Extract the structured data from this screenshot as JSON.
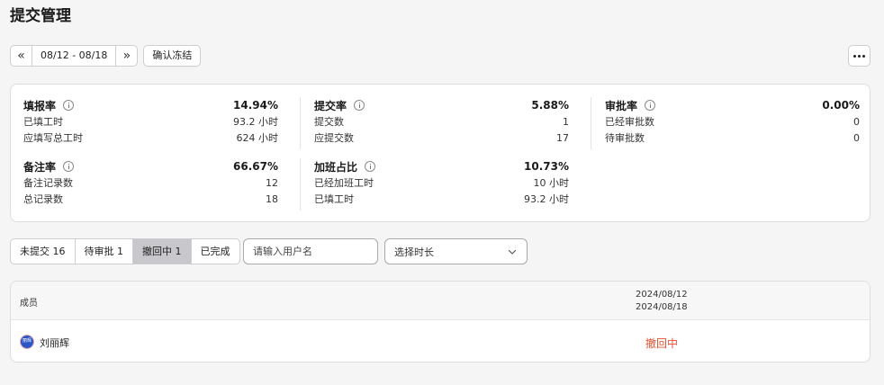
{
  "page": {
    "title": "提交管理"
  },
  "toolbar": {
    "prev_icon": "«",
    "next_icon": "»",
    "date_range": "08/12 - 08/18",
    "confirm_freeze_label": "确认冻结",
    "more_icon": "more-horizontal-icon"
  },
  "stats": {
    "fill_rate": {
      "name": "填报率",
      "value": "14.94%",
      "rows": [
        {
          "label": "已填工时",
          "value": "93.2 小时"
        },
        {
          "label": "应填写总工时",
          "value": "624 小时"
        }
      ]
    },
    "submit_rate": {
      "name": "提交率",
      "value": "5.88%",
      "rows": [
        {
          "label": "提交数",
          "value": "1"
        },
        {
          "label": "应提交数",
          "value": "17"
        }
      ]
    },
    "approve_rate": {
      "name": "审批率",
      "value": "0.00%",
      "rows": [
        {
          "label": "已经审批数",
          "value": "0"
        },
        {
          "label": "待审批数",
          "value": "0"
        }
      ]
    },
    "remark_rate": {
      "name": "备注率",
      "value": "66.67%",
      "rows": [
        {
          "label": "备注记录数",
          "value": "12"
        },
        {
          "label": "总记录数",
          "value": "18"
        }
      ]
    },
    "overtime_ratio": {
      "name": "加班占比",
      "value": "10.73%",
      "rows": [
        {
          "label": "已经加班工时",
          "value": "10 小时"
        },
        {
          "label": "已填工时",
          "value": "93.2 小时"
        }
      ]
    }
  },
  "filters": {
    "tabs": [
      {
        "label": "未提交 16"
      },
      {
        "label": "待审批 1"
      },
      {
        "label": "撤回中 1",
        "active": true
      },
      {
        "label": "已完成"
      }
    ],
    "search_placeholder": "请输入用户名",
    "duration_placeholder": "选择时长"
  },
  "table": {
    "col_member": "成员",
    "col_date_start": "2024/08/12",
    "col_date_end": "2024/08/18",
    "rows": [
      {
        "avatar_text": "丽辉",
        "name": "刘丽辉",
        "status": "撤回中"
      }
    ]
  },
  "colors": {
    "status_withdrawing": "#e8502d",
    "active_tab": "#c8c8cc"
  }
}
